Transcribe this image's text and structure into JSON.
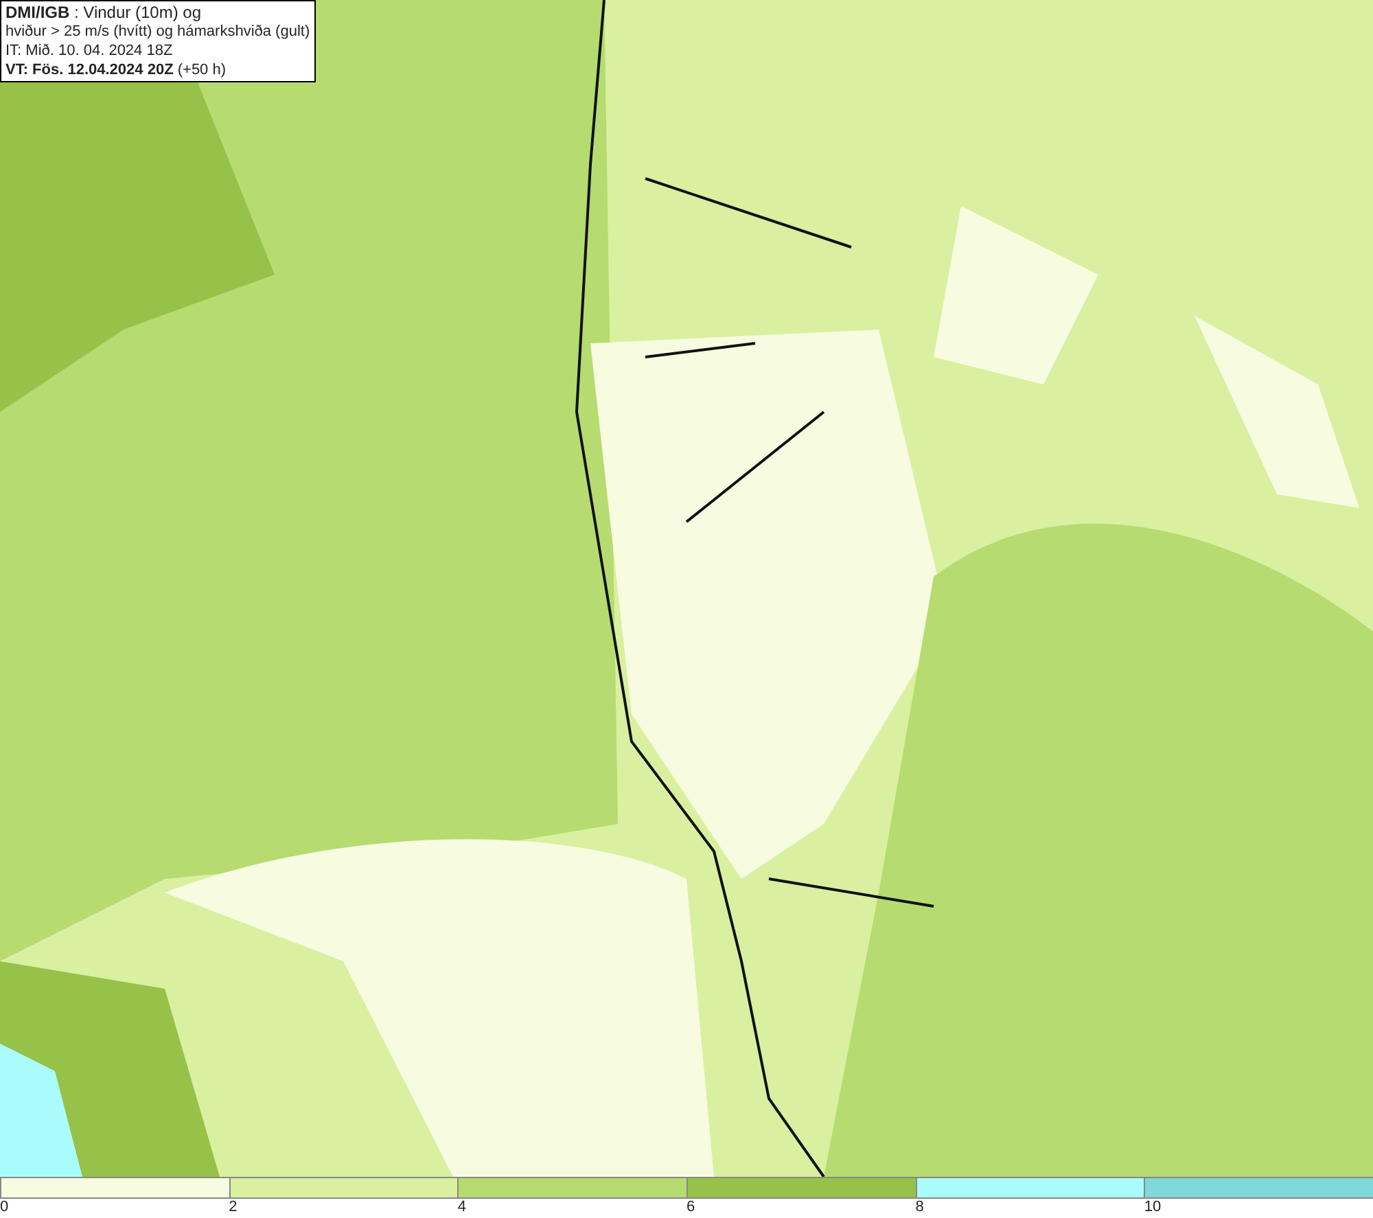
{
  "title_box": {
    "lines": [
      "**DMI/IGB** : Vindur (10m) og",
      "hviður > 25 m/s (hvítt) og hámarkshviða (gult)",
      "IT: Mið. 10. 04. 2024 18Z",
      "**VT: Fös. 12.04.2024 20Z** (+50 h)"
    ]
  },
  "legend": {
    "bins": [
      {
        "color": "#f7fbe0"
      },
      {
        "color": "#d9f0a0"
      },
      {
        "color": "#b6db70"
      },
      {
        "color": "#97c24a"
      },
      {
        "color": "#aafcfc"
      },
      {
        "color": "#80d8d8"
      }
    ],
    "ticks": [
      "0",
      "2",
      "4",
      "6",
      "8",
      "10"
    ]
  }
}
